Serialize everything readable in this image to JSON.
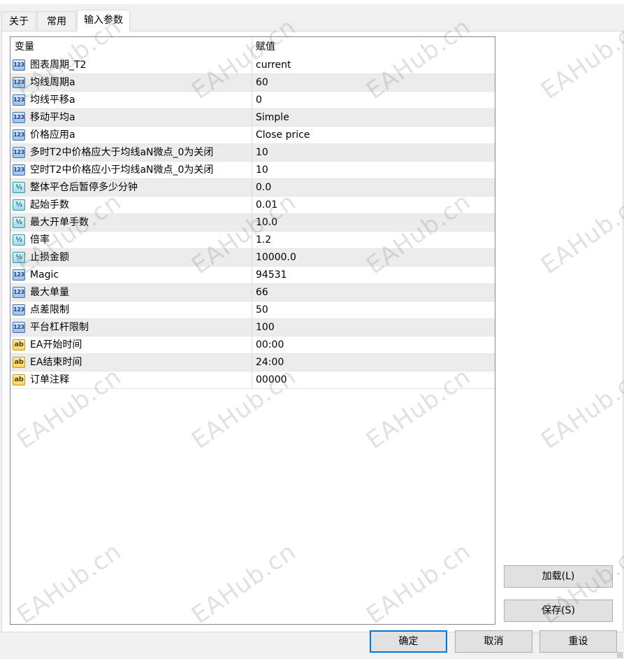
{
  "tabs": [
    {
      "label": "关于"
    },
    {
      "label": "常用"
    },
    {
      "label": "输入参数",
      "active": true
    }
  ],
  "grid": {
    "col_variable": "变量",
    "col_value": "赋值",
    "rows": [
      {
        "type": "int",
        "icon_text": "123",
        "name": "图表周期_T2",
        "value": "current"
      },
      {
        "type": "int",
        "icon_text": "123",
        "name": "均线周期a",
        "value": "60"
      },
      {
        "type": "int",
        "icon_text": "123",
        "name": "均线平移a",
        "value": "0"
      },
      {
        "type": "int",
        "icon_text": "123",
        "name": "移动平均a",
        "value": "Simple"
      },
      {
        "type": "int",
        "icon_text": "123",
        "name": "价格应用a",
        "value": "Close price"
      },
      {
        "type": "int",
        "icon_text": "123",
        "name": "多时T2中价格应大于均线aN微点_0为关闭",
        "value": "10"
      },
      {
        "type": "int",
        "icon_text": "123",
        "name": "空时T2中价格应小于均线aN微点_0为关闭",
        "value": "10"
      },
      {
        "type": "double",
        "icon_text": "½",
        "name": "整体平仓后暂停多少分钟",
        "value": "0.0"
      },
      {
        "type": "double",
        "icon_text": "½",
        "name": "起始手数",
        "value": "0.01"
      },
      {
        "type": "double",
        "icon_text": "½",
        "name": "最大开单手数",
        "value": "10.0"
      },
      {
        "type": "double",
        "icon_text": "½",
        "name": "倍率",
        "value": "1.2"
      },
      {
        "type": "double",
        "icon_text": "½",
        "name": "止损金额",
        "value": "10000.0"
      },
      {
        "type": "int",
        "icon_text": "123",
        "name": "Magic",
        "value": "94531"
      },
      {
        "type": "int",
        "icon_text": "123",
        "name": "最大单量",
        "value": "66"
      },
      {
        "type": "int",
        "icon_text": "123",
        "name": "点差限制",
        "value": "50"
      },
      {
        "type": "int",
        "icon_text": "123",
        "name": "平台杠杆限制",
        "value": "100"
      },
      {
        "type": "string",
        "icon_text": "ab",
        "name": "EA开始时间",
        "value": "00:00"
      },
      {
        "type": "string",
        "icon_text": "ab",
        "name": "EA结束时间",
        "value": "24:00"
      },
      {
        "type": "string",
        "icon_text": "ab",
        "name": "订单注释",
        "value": "00000"
      }
    ]
  },
  "buttons": {
    "load": "加载(L)",
    "save": "保存(S)",
    "ok": "确定",
    "cancel": "取消",
    "reset": "重设"
  },
  "watermark": "EAHub.cn"
}
